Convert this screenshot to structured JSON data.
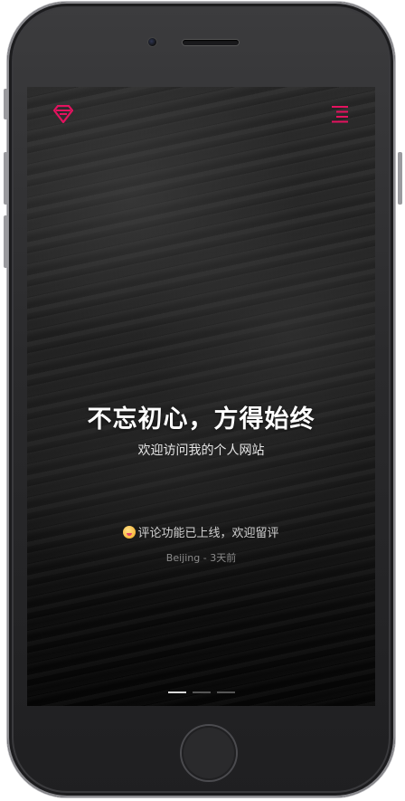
{
  "colors": {
    "accent": "#e4125f",
    "title_text": "#ffffff",
    "subtitle_text": "#e6e6e6",
    "meta_text": "#8a8a8a"
  },
  "header": {
    "logo_icon": "gem-logo-icon",
    "menu_icon": "hamburger-menu-icon"
  },
  "hero": {
    "title": "不忘初心，方得始终",
    "subtitle": "欢迎访问我的个人网站"
  },
  "notice": {
    "icon": "tongue-out-emoji-icon",
    "text": "评论功能已上线，欢迎留评",
    "location": "Beijing",
    "separator": "-",
    "time": "3天前"
  },
  "pager": {
    "count": 3,
    "active_index": 0
  }
}
